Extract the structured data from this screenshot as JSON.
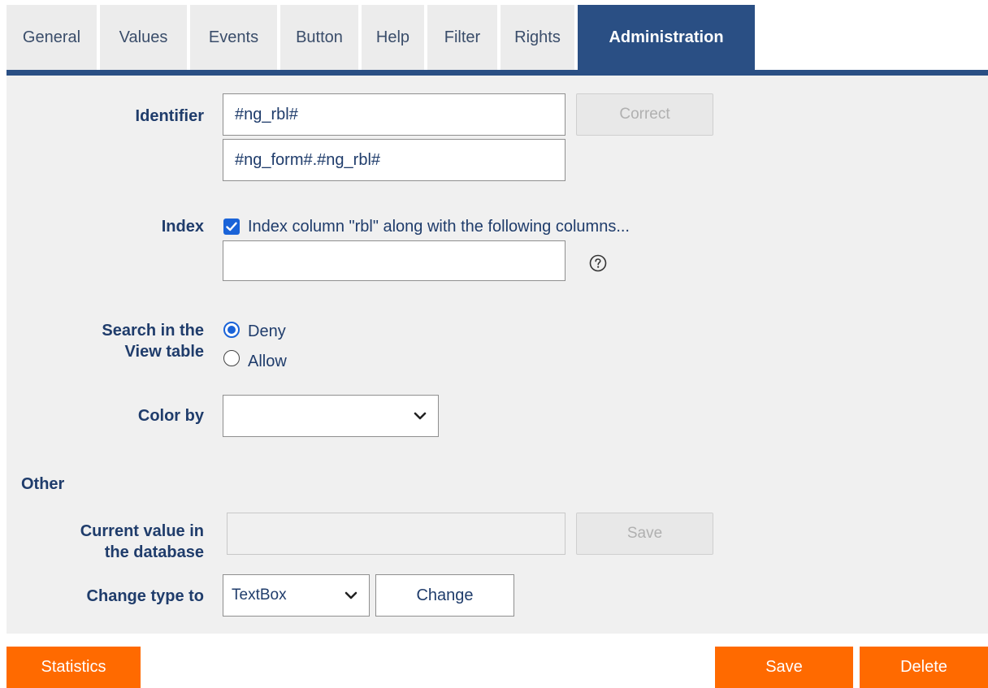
{
  "tabs": [
    {
      "label": "General"
    },
    {
      "label": "Values"
    },
    {
      "label": "Events"
    },
    {
      "label": "Button"
    },
    {
      "label": "Help"
    },
    {
      "label": "Filter"
    },
    {
      "label": "Rights"
    },
    {
      "label": "Administration",
      "active": true
    }
  ],
  "identifier": {
    "label": "Identifier",
    "value": "#ng_rbl#",
    "full_value": "#ng_form#.#ng_rbl#",
    "correct_label": "Correct"
  },
  "index": {
    "label": "Index",
    "checked": true,
    "checkbox_label": "Index column \"rbl\" along with the following columns...",
    "columns_value": "",
    "help_icon": "question-circle-icon"
  },
  "search": {
    "label_line1": "Search in the",
    "label_line2": "View table",
    "options": [
      {
        "label": "Deny",
        "selected": true
      },
      {
        "label": "Allow",
        "selected": false
      }
    ]
  },
  "color_by": {
    "label": "Color by",
    "selected": ""
  },
  "other": {
    "heading": "Other",
    "current_value_line1": "Current value in",
    "current_value_line2": "the database",
    "current_value": "",
    "save_label": "Save",
    "change_type_label": "Change type to",
    "change_type_selected": "TextBox",
    "change_label": "Change"
  },
  "footer": {
    "statistics_label": "Statistics",
    "save_label": "Save",
    "delete_label": "Delete"
  },
  "colors": {
    "accent": "#2a4f84",
    "action": "#ff6a00",
    "checkbox": "#1a63d8"
  }
}
